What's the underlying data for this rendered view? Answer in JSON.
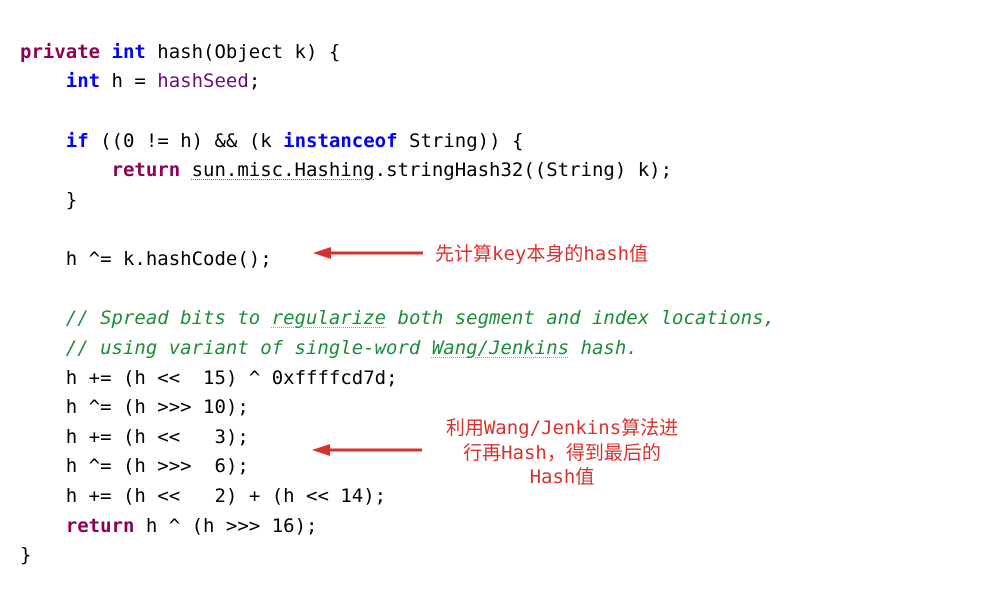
{
  "code": {
    "line1_private": "private",
    "line1_int": " int ",
    "line1_name": "hash(Object k) {",
    "line2_indent": "    ",
    "line2_int": "int ",
    "line2_var": "h = ",
    "line2_field": "hashSeed",
    "line2_semi": ";",
    "line3": "",
    "line4_indent": "    ",
    "line4_if": "if ",
    "line4_cond1": "((",
    "line4_zero": "0 ",
    "line4_ne": "!= h) && (k ",
    "line4_instanceof": "instanceof ",
    "line4_string": "String)) {",
    "line5_indent": "        ",
    "line5_return": "return ",
    "line5_sun": "sun.misc.Hashing",
    "line5_call": ".stringHash32((String) k);",
    "line6_indent": "    ",
    "line6_brace": "}",
    "line7": "",
    "line8_indent": "    ",
    "line8_code": "h ^= k.hashCode();",
    "line9": "",
    "line10_indent": "    ",
    "line10_comment_a": "// Spread bits to ",
    "line10_comment_typo": "regularize",
    "line10_comment_b": " both segment and index locations,",
    "line11_indent": "    ",
    "line11_comment_a": "// using variant of single-word ",
    "line11_comment_typo": "Wang/Jenkins",
    "line11_comment_b": " hash.",
    "line12_indent": "    ",
    "line12_code_a": "h += (h <<  ",
    "line12_num": "15",
    "line12_code_b": ") ^ ",
    "line12_hex": "0xffffcd7d",
    "line12_semi": ";",
    "line13_indent": "    ",
    "line13_code_a": "h ^= (h >>> ",
    "line13_num": "10",
    "line13_code_b": ");",
    "line14_indent": "    ",
    "line14_code_a": "h += (h <<   ",
    "line14_num": "3",
    "line14_code_b": ");",
    "line15_indent": "    ",
    "line15_code_a": "h ^= (h >>>  ",
    "line15_num": "6",
    "line15_code_b": ");",
    "line16_indent": "    ",
    "line16_code_a": "h += (h <<   ",
    "line16_num": "2",
    "line16_code_b": ") + (h << ",
    "line16_num2": "14",
    "line16_code_c": ");",
    "line17_indent": "    ",
    "line17_return": "return ",
    "line17_code_a": "h ^ (h >>> ",
    "line17_num": "16",
    "line17_code_b": ");",
    "line18_brace": "}"
  },
  "annotations": {
    "note1": "先计算key本身的hash值",
    "note2_line1": "利用Wang/Jenkins算法进",
    "note2_line2": "行再Hash，得到最后的",
    "note2_line3": "Hash值"
  }
}
